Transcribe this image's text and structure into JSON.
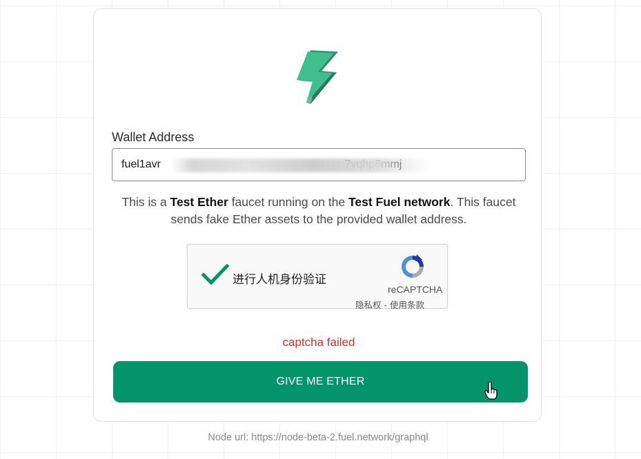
{
  "colors": {
    "brand_green": "#049469",
    "logo_green": "#3fbf8f",
    "error_red": "#d93025",
    "recaptcha_blue": "#1c3aa9",
    "recaptcha_light_blue": "#4a90e2",
    "recaptcha_gray": "#aaaaaa"
  },
  "form": {
    "logo_icon": "lightning-bolt-icon",
    "wallet_label": "Wallet Address",
    "wallet_value": "fuel1avr                                                            7vqhp8mmj",
    "description_before": "This is a ",
    "description_bold1": "Test Ether",
    "description_middle": " faucet running on the ",
    "description_bold2": "Test Fuel network",
    "description_after": ". This faucet sends fake Ether assets to the provided wallet address."
  },
  "recaptcha": {
    "check_icon": "checkmark-icon",
    "label": "进行人机身份验证",
    "brand": "reCAPTCHA",
    "privacy": "隐私权",
    "separator": " - ",
    "terms": "使用条款",
    "logo_icon": "recaptcha-logo-icon"
  },
  "status": {
    "error": "captcha failed"
  },
  "submit": {
    "label": "GIVE ME ETHER"
  },
  "footer": {
    "node_label": "Node url:",
    "node_url": "https://node-beta-2.fuel.network/graphql"
  }
}
